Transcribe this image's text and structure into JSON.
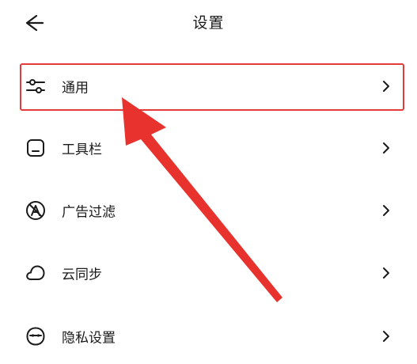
{
  "header": {
    "title": "设置"
  },
  "settings_items": [
    {
      "label": "通用",
      "icon": "sliders-icon"
    },
    {
      "label": "工具栏",
      "icon": "toolbar-icon"
    },
    {
      "label": "广告过滤",
      "icon": "ad-filter-icon"
    },
    {
      "label": "云同步",
      "icon": "cloud-icon"
    },
    {
      "label": "隐私设置",
      "icon": "privacy-mask-icon"
    }
  ],
  "annotation": {
    "highlight_color": "#e33a3a",
    "arrow_color": "#e8322e"
  }
}
